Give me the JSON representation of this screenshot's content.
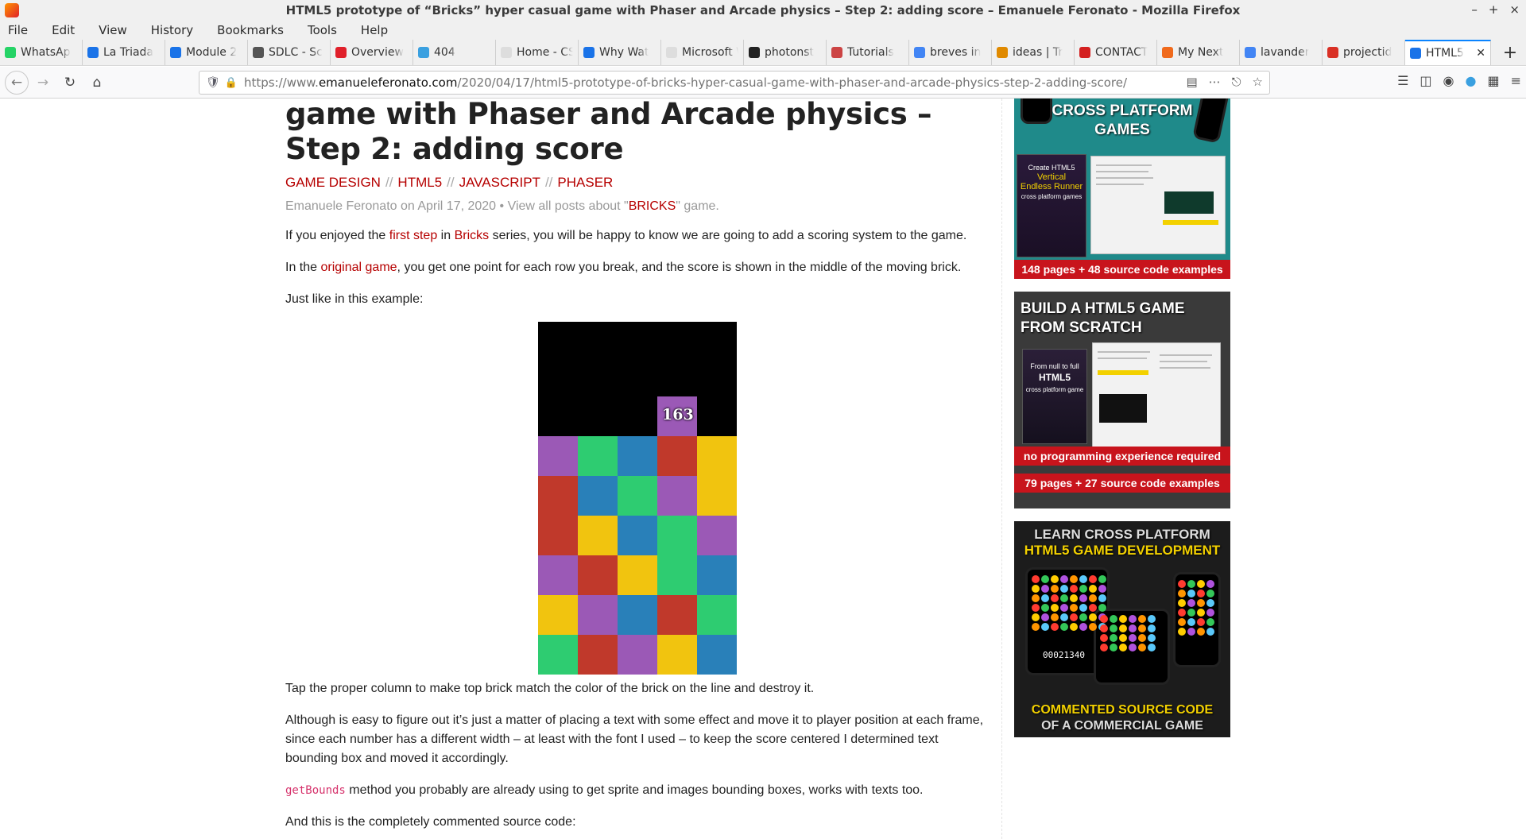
{
  "window": {
    "title": "HTML5 prototype of “Bricks” hyper casual game with Phaser and Arcade physics – Step 2: adding score – Emanuele Feronato - Mozilla Firefox",
    "controls": [
      "–",
      "+",
      "×"
    ]
  },
  "menu": [
    "File",
    "Edit",
    "View",
    "History",
    "Bookmarks",
    "Tools",
    "Help"
  ],
  "tabs": [
    {
      "label": "WhatsAp",
      "color": "#25d366"
    },
    {
      "label": "La Triada",
      "color": "#1a73e8"
    },
    {
      "label": "Module 2",
      "color": "#1a73e8"
    },
    {
      "label": "SDLC - Sc",
      "color": "#555555"
    },
    {
      "label": "Overview",
      "color": "#e0202a"
    },
    {
      "label": "404",
      "color": "#3aa0e0"
    },
    {
      "label": "Home - CSSE",
      "color": "#dddddd"
    },
    {
      "label": "Why Wat",
      "color": "#1a73e8"
    },
    {
      "label": "Microsoft W",
      "color": "#dddddd"
    },
    {
      "label": "photonst",
      "color": "#222222"
    },
    {
      "label": "Tutorials",
      "color": "#c44"
    },
    {
      "label": "breves in",
      "color": "#4285f4"
    },
    {
      "label": "ideas | Tr",
      "color": "#e08a00"
    },
    {
      "label": "CONTACT",
      "color": "#d42020"
    },
    {
      "label": "My Next",
      "color": "#f06a1c"
    },
    {
      "label": "lavander",
      "color": "#4285f4"
    },
    {
      "label": "projectid",
      "color": "#d93025"
    },
    {
      "label": "HTML5",
      "color": "#1a73e8",
      "active": true
    }
  ],
  "address": {
    "scheme": "https://www.",
    "host": "emanueleferonato.com",
    "path": "/2020/04/17/html5-prototype-of-bricks-hyper-casual-game-with-phaser-and-arcade-physics-step-2-adding-score/"
  },
  "article": {
    "title": "game with Phaser and Arcade physics – Step 2: adding score",
    "categories": [
      "GAME DESIGN",
      "HTML5",
      "JAVASCRIPT",
      "PHASER"
    ],
    "category_sep": "//",
    "meta": {
      "prefix": "Emanuele Feronato on April 17, 2020 • View all posts about \"",
      "tag": "BRICKS",
      "suffix": "\" game."
    },
    "p1": {
      "a": "If you enjoyed the ",
      "link1": "first step",
      "b": " in ",
      "link2": "Bricks",
      "c": " series, you will be happy to know we are going to add a scoring system to the game."
    },
    "p2": {
      "a": "In the ",
      "link": "original game",
      "b": ", you get one point for each row you break, and the score is shown in the middle of the moving brick."
    },
    "p3": "Just like in this example:",
    "game": {
      "score": "163",
      "colors": {
        "purple": "#9b59b6",
        "green": "#2ecc71",
        "blue": "#2980b9",
        "red": "#c0392b",
        "yellow": "#f1c40f"
      },
      "player": {
        "column": 3,
        "color": "purple"
      },
      "rows": [
        [
          "purple",
          "green",
          "blue",
          "red",
          "yellow"
        ],
        [
          "red",
          "blue",
          "green",
          "purple",
          "yellow"
        ],
        [
          "red",
          "yellow",
          "blue",
          "green",
          "purple"
        ],
        [
          "purple",
          "red",
          "yellow",
          "green",
          "blue"
        ],
        [
          "yellow",
          "purple",
          "blue",
          "red",
          "green"
        ],
        [
          "green",
          "red",
          "purple",
          "yellow",
          "blue"
        ]
      ]
    },
    "p4": "Tap the proper column to make top brick match the color of the brick on the line and destroy it.",
    "p5": "Although is easy to figure out it’s just a matter of placing a text with some effect and move it to player position at each frame, since each number has a different width – at least with the font I used – to keep the score centered I determined text bounding box and moved it accordingly.",
    "p6": {
      "code": "getBounds",
      "text": " method you probably are already using to get sprite and images bounding boxes, works with texts too."
    },
    "p7": "And this is the completely commented source code:"
  },
  "ads": {
    "ad1": {
      "heading_1": "CROSS PLATFORM",
      "heading_2": "GAMES",
      "book_1": "Create HTML5",
      "book_2": "Vertical",
      "book_3": "Endless Runner",
      "book_4": "cross platform games",
      "strip": "148 pages + 48 source code examples"
    },
    "ad2": {
      "heading_1": "BUILD A HTML5 GAME",
      "heading_2": "FROM SCRATCH",
      "book_1": "From null to full",
      "book_2": "HTML5",
      "book_3": "cross platform game",
      "strip_1": "no programming experience required",
      "strip_2": "79 pages + 27 source code examples"
    },
    "ad3": {
      "heading_1": "LEARN CROSS PLATFORM",
      "heading_2": "HTML5 GAME DEVELOPMENT",
      "score": "00021340",
      "footer_1": "COMMENTED SOURCE CODE",
      "footer_2": "OF A COMMERCIAL GAME"
    }
  }
}
